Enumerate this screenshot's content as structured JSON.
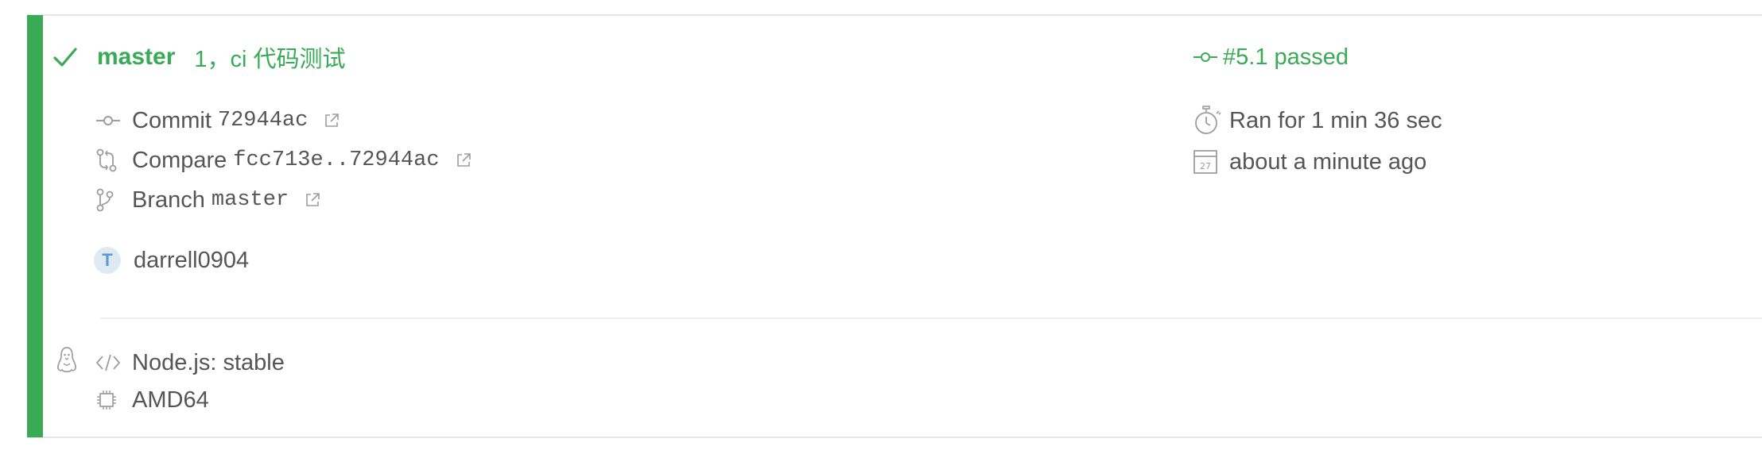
{
  "build": {
    "branch": "master",
    "commit_message": "1，ci 代码测试",
    "status_text": "#5.1 passed",
    "commit_label": "Commit",
    "commit_sha": "72944ac",
    "compare_label": "Compare",
    "compare_range": "fcc713e..72944ac",
    "branch_label": "Branch",
    "branch_name": "master",
    "author": "darrell0904",
    "avatar_letter": "T",
    "duration": "Ran for 1 min 36 sec",
    "finished": "about a minute ago"
  },
  "job": {
    "language": "Node.js: stable",
    "arch": "AMD64"
  },
  "colors": {
    "passed": "#39aa56",
    "text": "#555555",
    "icon": "#9d9d9d"
  },
  "icons": {
    "status": "check-icon",
    "os": "linux-tux-icon",
    "commit": "commit-icon",
    "compare": "compare-icon",
    "branch": "branch-icon",
    "external": "external-link-icon",
    "timer": "stopwatch-icon",
    "calendar": "calendar-icon",
    "language": "code-icon",
    "arch": "cpu-icon"
  }
}
